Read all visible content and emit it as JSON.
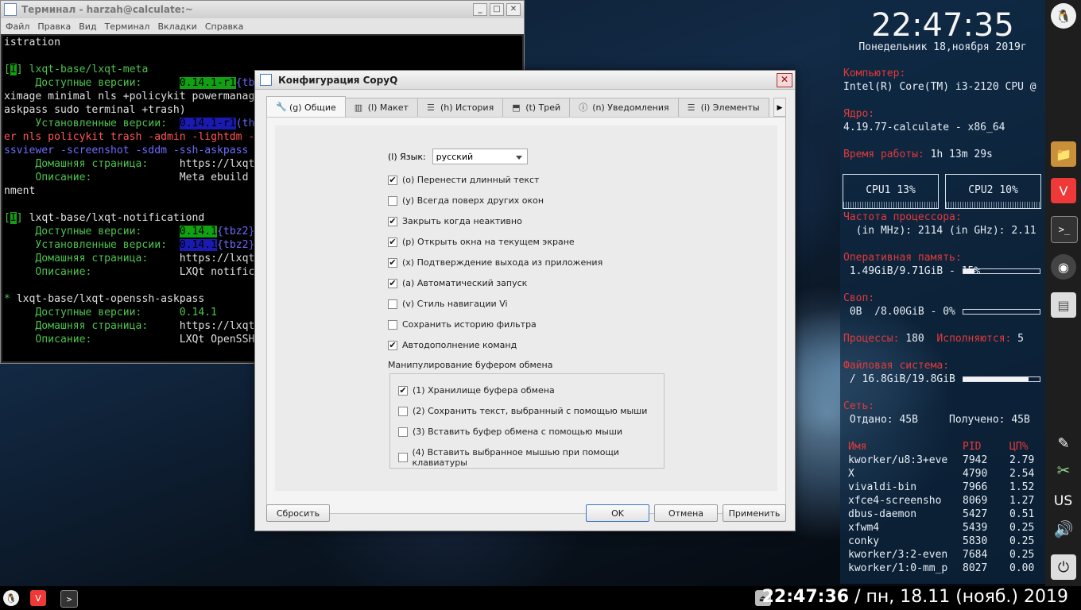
{
  "terminal": {
    "title": "Терминал - harzah@calculate:~",
    "menu": [
      "Файл",
      "Правка",
      "Вид",
      "Терминал",
      "Вкладки",
      "Справка"
    ],
    "lines": [
      [
        {
          "t": "istration"
        }
      ],
      [
        {
          "t": ""
        }
      ],
      [
        {
          "t": "[",
          "c": "g"
        },
        {
          "t": "I",
          "c": "hl-g"
        },
        {
          "t": "] ",
          "c": "g"
        },
        {
          "t": "lxqt-base/lxqt-meta",
          "c": "g"
        }
      ],
      [
        {
          "t": "     Доступные версии:      ",
          "c": "g"
        },
        {
          "t": "0.14.1-r1",
          "c": "hl-g"
        },
        {
          "t": "{tb",
          "c": "b"
        }
      ],
      [
        {
          "t": "ximage minimal nls +policykit powermanag"
        }
      ],
      [
        {
          "t": "askpass sudo terminal +trash)"
        }
      ],
      [
        {
          "t": "     Установленные версии:  ",
          "c": "g"
        },
        {
          "t": "0.14.1-r1",
          "c": "hl-b"
        },
        {
          "t": "(th",
          "c": "b"
        }
      ],
      [
        {
          "t": "er nls policykit trash -admin -lightdm -",
          "c": "r"
        }
      ],
      [
        {
          "t": "ssviewer -screenshot -sddm -ssh-askpass",
          "c": "b"
        }
      ],
      [
        {
          "t": "     Домашняя страница:     ",
          "c": "g"
        },
        {
          "t": "https://lxqt"
        }
      ],
      [
        {
          "t": "     Описание:              ",
          "c": "g"
        },
        {
          "t": "Meta ebuild"
        }
      ],
      [
        {
          "t": "nment"
        }
      ],
      [
        {
          "t": ""
        }
      ],
      [
        {
          "t": "[",
          "c": "g"
        },
        {
          "t": "I",
          "c": "hl-g"
        },
        {
          "t": "] ",
          "c": "g"
        },
        {
          "t": "lxqt-base/lxqt-notificationd"
        }
      ],
      [
        {
          "t": "     Доступные версии:      ",
          "c": "g"
        },
        {
          "t": "0.14.1",
          "c": "hl-g"
        },
        {
          "t": "{tbz2}",
          "c": "b"
        }
      ],
      [
        {
          "t": "     Установленные версии:  ",
          "c": "g"
        },
        {
          "t": "0.14.1",
          "c": "hl-b"
        },
        {
          "t": "{tbz2}",
          "c": "b"
        }
      ],
      [
        {
          "t": "     Домашняя страница:     ",
          "c": "g"
        },
        {
          "t": "https://lxqt"
        }
      ],
      [
        {
          "t": "     Описание:              ",
          "c": "g"
        },
        {
          "t": "LXQt notific"
        }
      ],
      [
        {
          "t": ""
        }
      ],
      [
        {
          "t": "* ",
          "c": "g"
        },
        {
          "t": "lxqt-base/lxqt-openssh-askpass"
        }
      ],
      [
        {
          "t": "     Доступные версии:      ",
          "c": "g"
        },
        {
          "t": "0.14.1",
          "c": "g"
        }
      ],
      [
        {
          "t": "     Домашняя страница:     ",
          "c": "g"
        },
        {
          "t": "https://lxqt"
        }
      ],
      [
        {
          "t": "     Описание:              ",
          "c": "g"
        },
        {
          "t": "LXQt OpenSSH"
        }
      ]
    ]
  },
  "dialog": {
    "title": "Конфигурация CopyQ",
    "tabs": [
      {
        "label": "(g) Общие",
        "icon": "wrench-icon",
        "glyph": "🔧"
      },
      {
        "label": "(l) Макет",
        "icon": "layout-icon",
        "glyph": "▥"
      },
      {
        "label": "(h) История",
        "icon": "list-icon",
        "glyph": "☰"
      },
      {
        "label": "(t) Трей",
        "icon": "tray-icon",
        "glyph": "⬒"
      },
      {
        "label": "(n) Уведомления",
        "icon": "info-icon",
        "glyph": "ⓘ"
      },
      {
        "label": "(i) Элементы",
        "icon": "items-icon",
        "glyph": "☰"
      }
    ],
    "language_label": "(l) Язык:",
    "language_value": "русский",
    "options": [
      {
        "label": "(o) Перенести длинный текст",
        "checked": true
      },
      {
        "label": "(y) Всегда поверх других окон",
        "checked": false
      },
      {
        "label": "Закрыть когда неактивно",
        "checked": true
      },
      {
        "label": "(p) Открыть окна на текущем экране",
        "checked": true
      },
      {
        "label": "(x) Подтверждение выхода из приложения",
        "checked": true
      },
      {
        "label": "(a) Автоматический запуск",
        "checked": true
      },
      {
        "label": "(v) Стиль навигации Vi",
        "checked": false
      },
      {
        "label": "Сохранить историю фильтра",
        "checked": false
      },
      {
        "label": "Автодополнение команд",
        "checked": true
      }
    ],
    "clipboard_group_label": "Манипулирование буфером обмена",
    "clipboard_options": [
      {
        "label": "(1) Хранилище буфера обмена",
        "checked": true
      },
      {
        "label": "(2) Сохранить текст, выбранный  с помощью мыши",
        "checked": false
      },
      {
        "label": "(3) Вставить буфер обмена с помощью мыши",
        "checked": false
      },
      {
        "label": "(4) Вставить выбранное мышью при помощи клавиатуры",
        "checked": false
      }
    ],
    "buttons": {
      "reset": "Сбросить",
      "ok": "OK",
      "cancel": "Отмена",
      "apply": "Применить"
    }
  },
  "conky": {
    "time": "22:47:35",
    "date": "Понедельник 18,ноября 2019г",
    "computer_label": "Компьютер:",
    "cpu_model": "Intel(R) Core(TM) i3-2120 CPU @",
    "kernel_label": "Ядро:",
    "kernel": "4.19.77-calculate - x86_64",
    "uptime_label": "Время работы:",
    "uptime": "1h 13m 29s",
    "cpu1": "CPU1  13%",
    "cpu2": "CPU2  10%",
    "freq_label": "Частота процессора:",
    "freq": "  (in MHz): 2114 (in GHz): 2.11",
    "ram_label": "Оперативная память:",
    "ram": " 1.49GiB/9.71GiB - 15%",
    "ram_pct": 15,
    "swap_label": "Своп:",
    "swap": " 0B  /8.00GiB - 0%",
    "swap_pct": 0,
    "procs_label": "Процессы:",
    "procs": "180",
    "running_label": "Исполняются:",
    "running": "5",
    "fs_label": "Файловая система:",
    "fs": " / 16.8GiB/19.8GiB",
    "fs_pct": 85,
    "net_label": "Сеть:",
    "net": " Отдано: 45B     Получено: 45B",
    "proc_headers": [
      "Имя",
      "PID",
      "ЦП%"
    ],
    "processes": [
      [
        "kworker/u8:3+eve",
        "7942",
        "2.79"
      ],
      [
        "X",
        "4790",
        "2.54"
      ],
      [
        "vivaldi-bin",
        "7966",
        "1.52"
      ],
      [
        "xfce4-screensho",
        "8069",
        "1.27"
      ],
      [
        "dbus-daemon",
        "5427",
        "0.51"
      ],
      [
        "xfwm4",
        "5439",
        "0.25"
      ],
      [
        "conky",
        "5830",
        "0.25"
      ],
      [
        "kworker/3:2-even",
        "7684",
        "0.25"
      ],
      [
        "kworker/1:0-mm_p",
        "8027",
        "0.00"
      ]
    ]
  },
  "dock": {
    "keyboard_layout": "US"
  },
  "taskbar": {
    "clock_time": "22:47:36",
    "clock_date": " / пн, 18.11 (нояб.) 2019"
  }
}
